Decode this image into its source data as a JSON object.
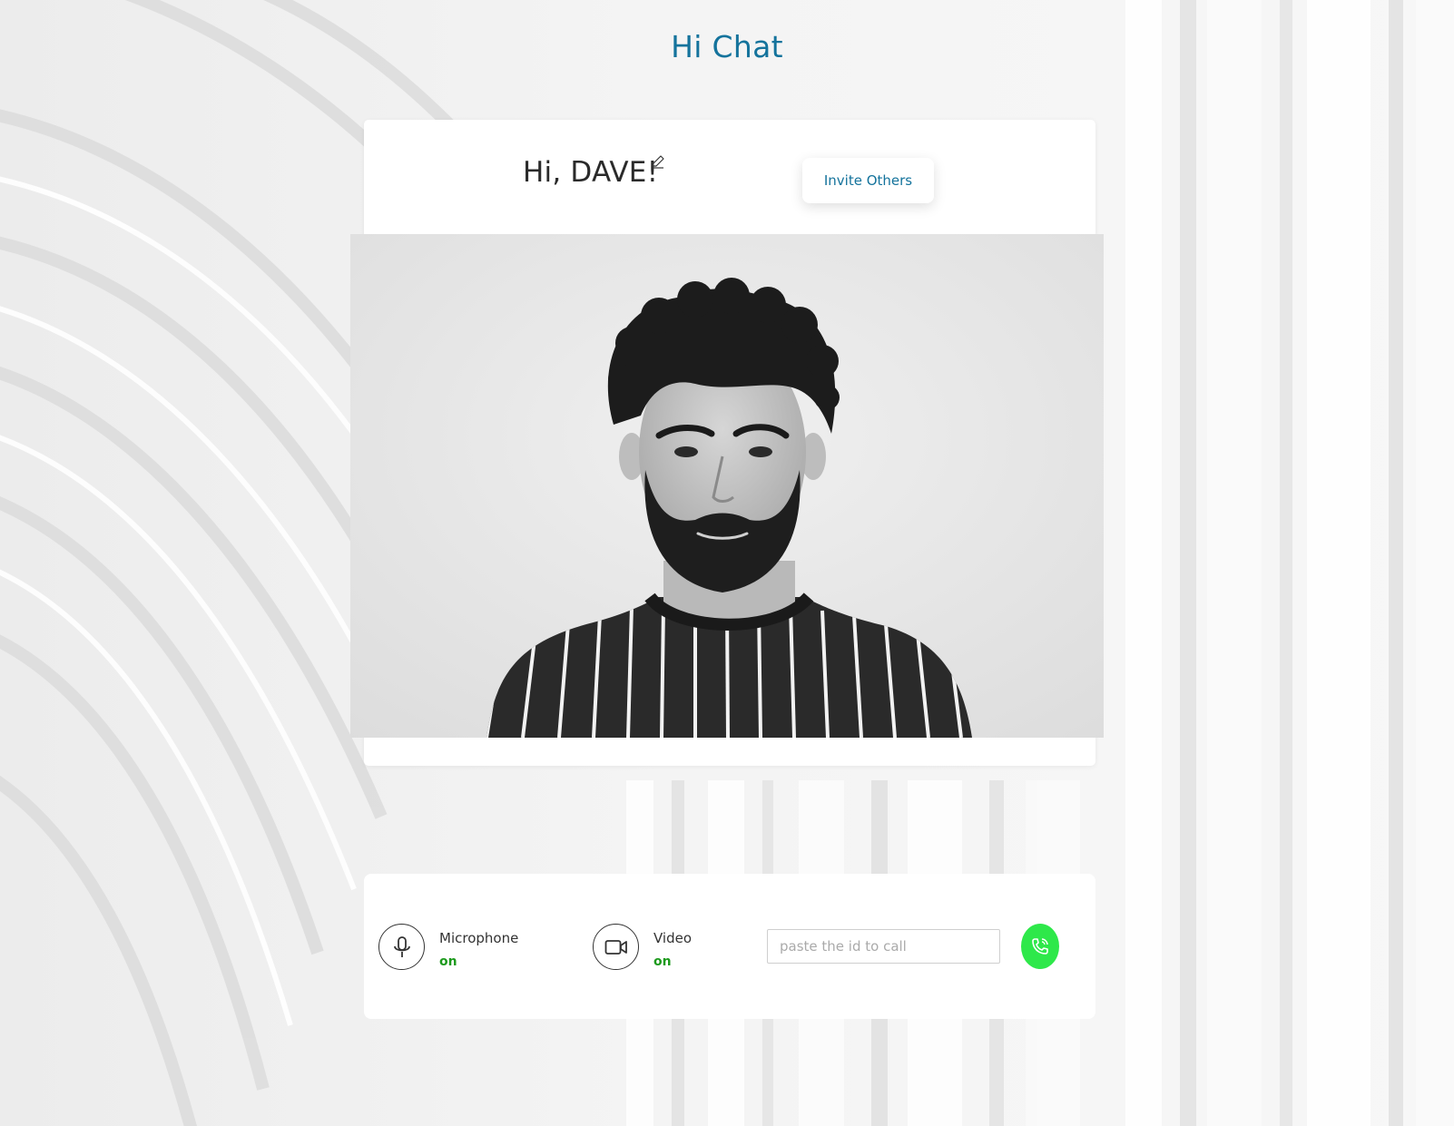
{
  "app": {
    "title": "Hi Chat"
  },
  "header": {
    "greeting": "Hi, DAVE!",
    "edit_icon": "pencil-icon",
    "invite_label": "Invite Others"
  },
  "video": {
    "description_icon": "video-feed"
  },
  "controls": {
    "microphone": {
      "label": "Microphone",
      "status": "on",
      "icon": "microphone-icon"
    },
    "video": {
      "label": "Video",
      "status": "on",
      "icon": "video-camera-icon"
    },
    "call_input": {
      "placeholder": "paste the id to call",
      "value": ""
    },
    "call_button_icon": "phone-icon"
  },
  "colors": {
    "brand": "#14739c",
    "status_on": "#1d9a1d",
    "call_button": "#2ee84a"
  }
}
